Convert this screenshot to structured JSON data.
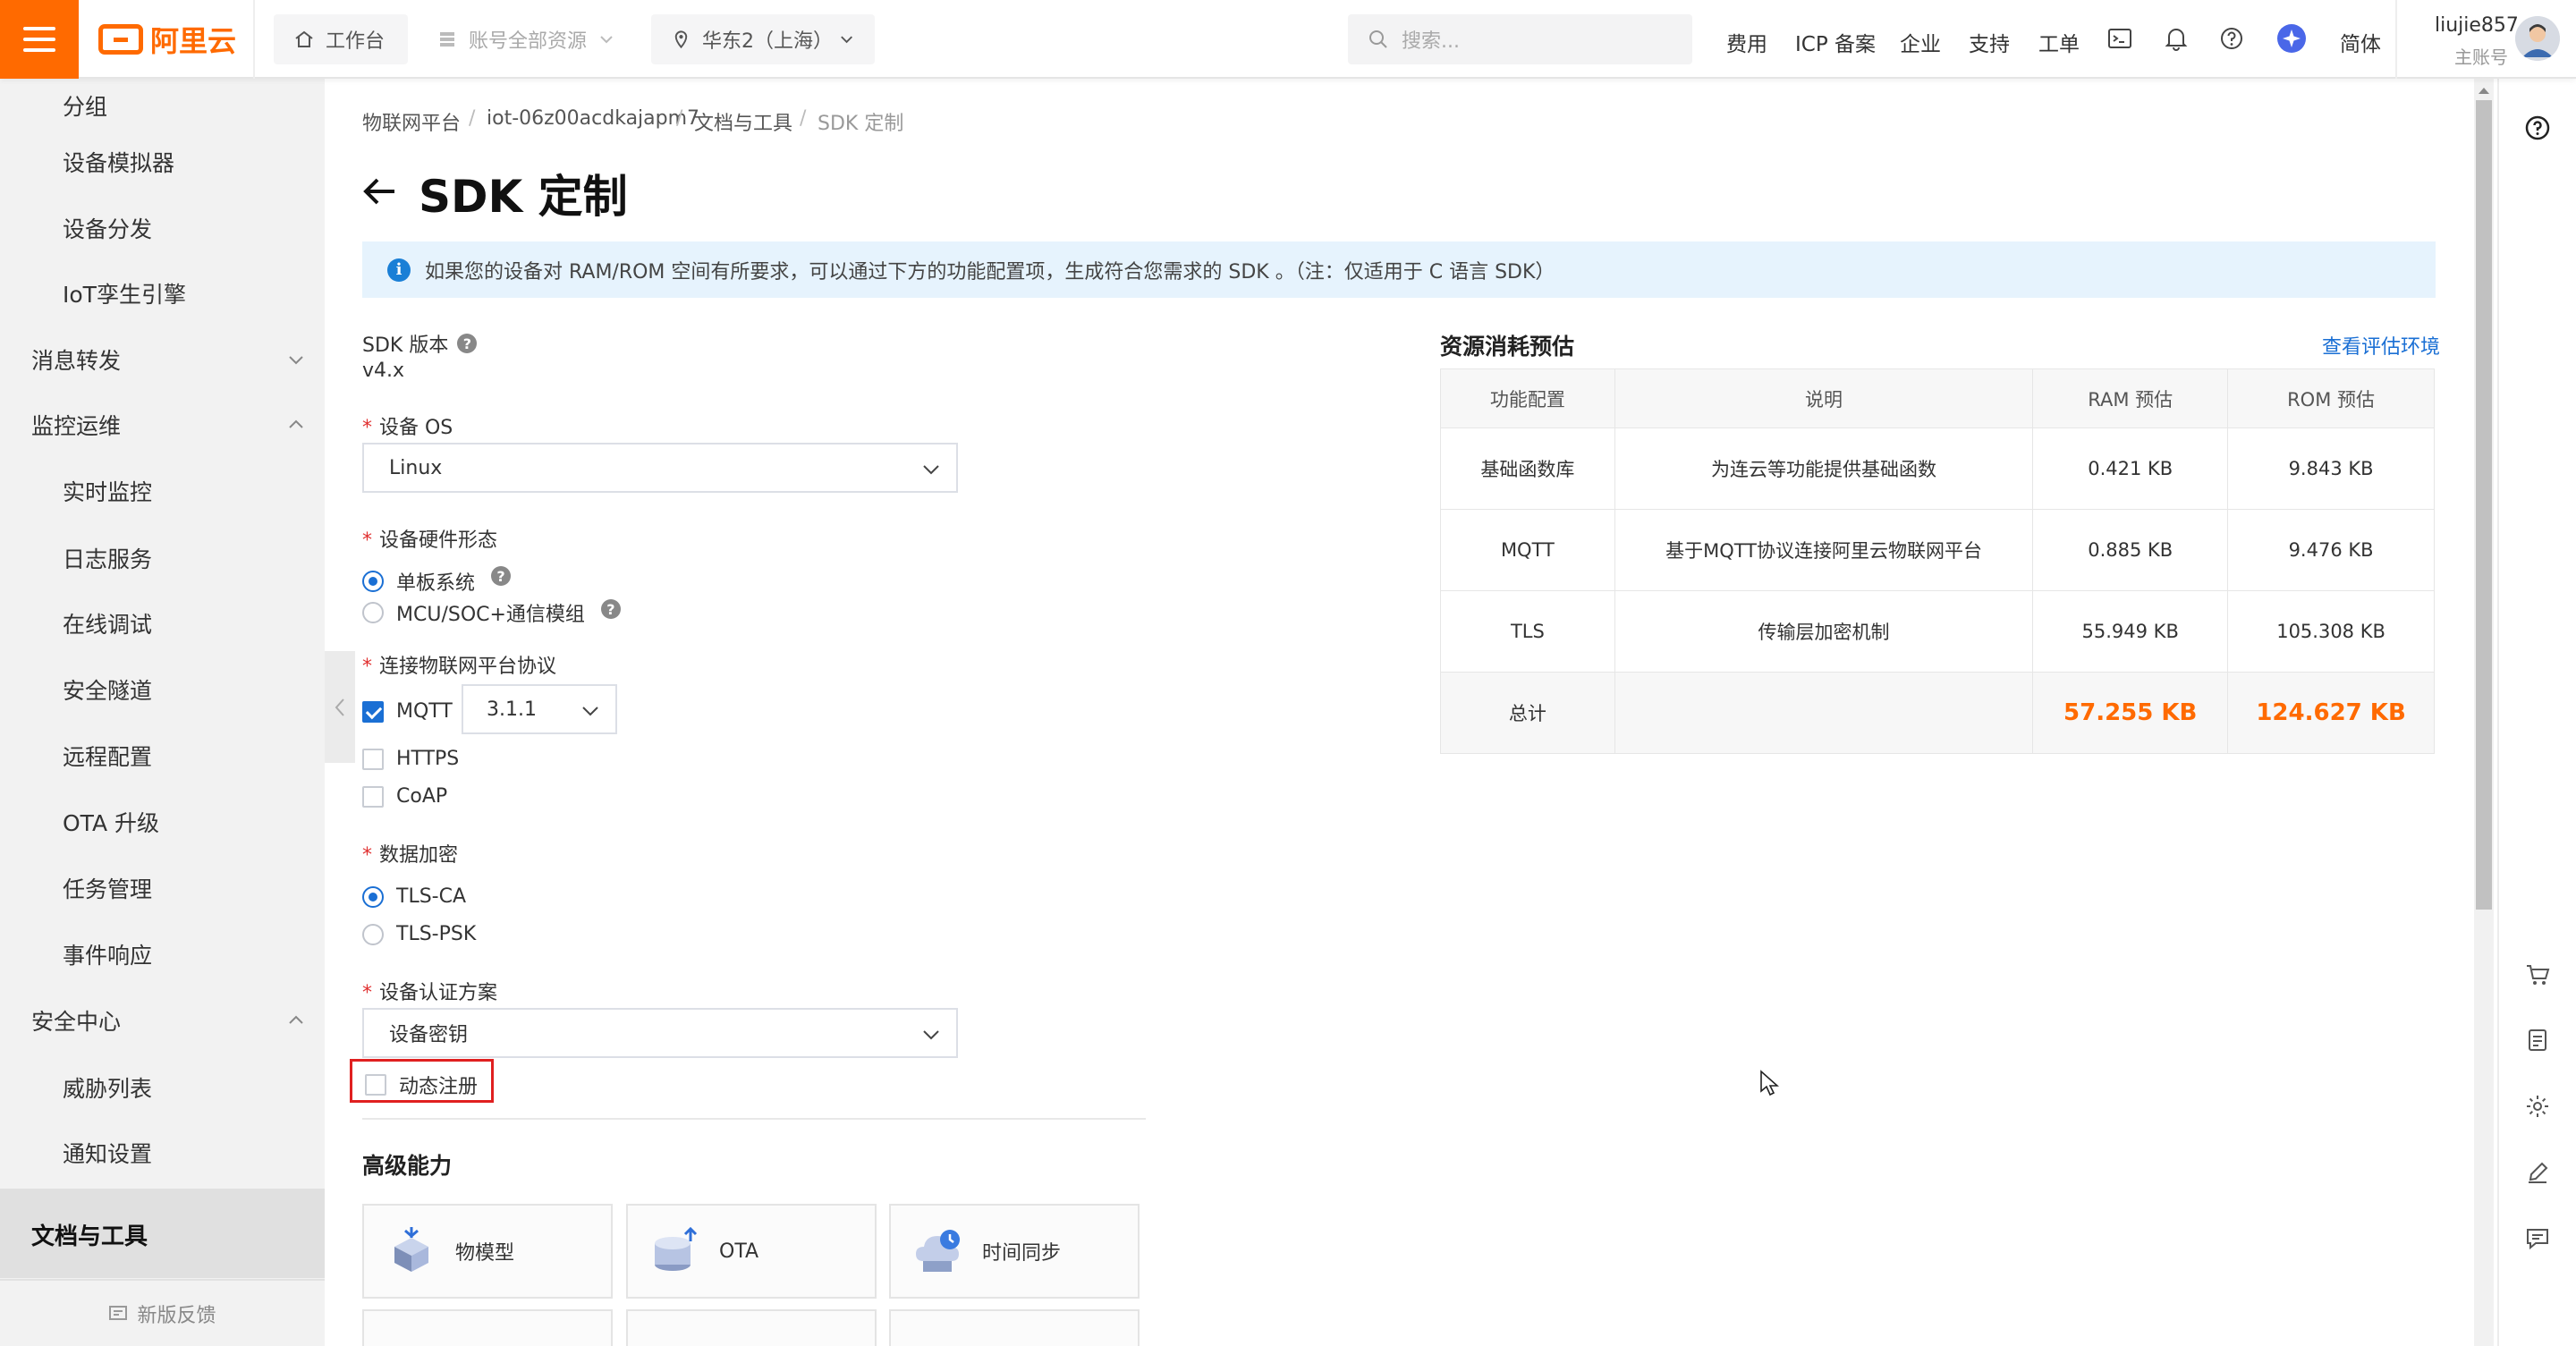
{
  "topbar": {
    "logo": "阿里云",
    "workbench": "工作台",
    "resource_group": "账号全部资源",
    "region": "华东2（上海）",
    "search_placeholder": "搜索...",
    "links": [
      "费用",
      "ICP 备案",
      "企业",
      "支持",
      "工单"
    ],
    "lang": "简体",
    "user_name": "liujie857",
    "user_role": "主账号"
  },
  "sidebar": {
    "items": [
      {
        "label": "分组",
        "type": "sub"
      },
      {
        "label": "设备模拟器",
        "type": "sub"
      },
      {
        "label": "设备分发",
        "type": "sub"
      },
      {
        "label": "IoT孪生引擎",
        "type": "sub"
      },
      {
        "label": "消息转发",
        "type": "group",
        "chevron": "down"
      },
      {
        "label": "监控运维",
        "type": "group",
        "chevron": "up"
      },
      {
        "label": "实时监控",
        "type": "sub"
      },
      {
        "label": "日志服务",
        "type": "sub"
      },
      {
        "label": "在线调试",
        "type": "sub"
      },
      {
        "label": "安全隧道",
        "type": "sub"
      },
      {
        "label": "远程配置",
        "type": "sub"
      },
      {
        "label": "OTA 升级",
        "type": "sub"
      },
      {
        "label": "任务管理",
        "type": "sub"
      },
      {
        "label": "事件响应",
        "type": "sub"
      },
      {
        "label": "安全中心",
        "type": "group",
        "chevron": "up"
      },
      {
        "label": "威胁列表",
        "type": "sub"
      },
      {
        "label": "通知设置",
        "type": "sub"
      }
    ],
    "active": "文档与工具",
    "feedback": "新版反馈"
  },
  "breadcrumb": [
    "物联网平台",
    "iot-06z00acdkajapm7",
    "文档与工具",
    "SDK 定制"
  ],
  "page_title": "SDK 定制",
  "notice": "如果您的设备对 RAM/ROM 空间有所要求，可以通过下方的功能配置项，生成符合您需求的 SDK 。（注：仅适用于 C 语言 SDK）",
  "form": {
    "sdk_version_label": "SDK 版本",
    "sdk_version": "v4.x",
    "os_label": "设备 OS",
    "os_value": "Linux",
    "hardware_label": "设备硬件形态",
    "hardware_options": [
      "单板系统",
      "MCU/SOC+通信模组"
    ],
    "protocol_label": "连接物联网平台协议",
    "protocols": [
      "MQTT",
      "HTTPS",
      "CoAP"
    ],
    "mqtt_version": "3.1.1",
    "encrypt_label": "数据加密",
    "encrypt_options": [
      "TLS-CA",
      "TLS-PSK"
    ],
    "auth_label": "设备认证方案",
    "auth_value": "设备密钥",
    "dynamic_register": "动态注册"
  },
  "advanced": {
    "title": "高级能力",
    "cards": [
      "物模型",
      "OTA",
      "时间同步"
    ]
  },
  "resource": {
    "title": "资源消耗预估",
    "link": "查看评估环境",
    "headers": [
      "功能配置",
      "说明",
      "RAM 预估",
      "ROM 预估"
    ],
    "rows": [
      [
        "基础函数库",
        "为连云等功能提供基础函数",
        "0.421 KB",
        "9.843 KB"
      ],
      [
        "MQTT",
        "基于MQTT协议连接阿里云物联网平台",
        "0.885 KB",
        "9.476 KB"
      ],
      [
        "TLS",
        "传输层加密机制",
        "55.949 KB",
        "105.308 KB"
      ]
    ],
    "total_label": "总计",
    "total_ram": "57.255 KB",
    "total_rom": "124.627 KB"
  },
  "colors": {
    "brand": "#ff6a00",
    "primary": "#1a6fd4",
    "highlight_box": "#e02020"
  }
}
